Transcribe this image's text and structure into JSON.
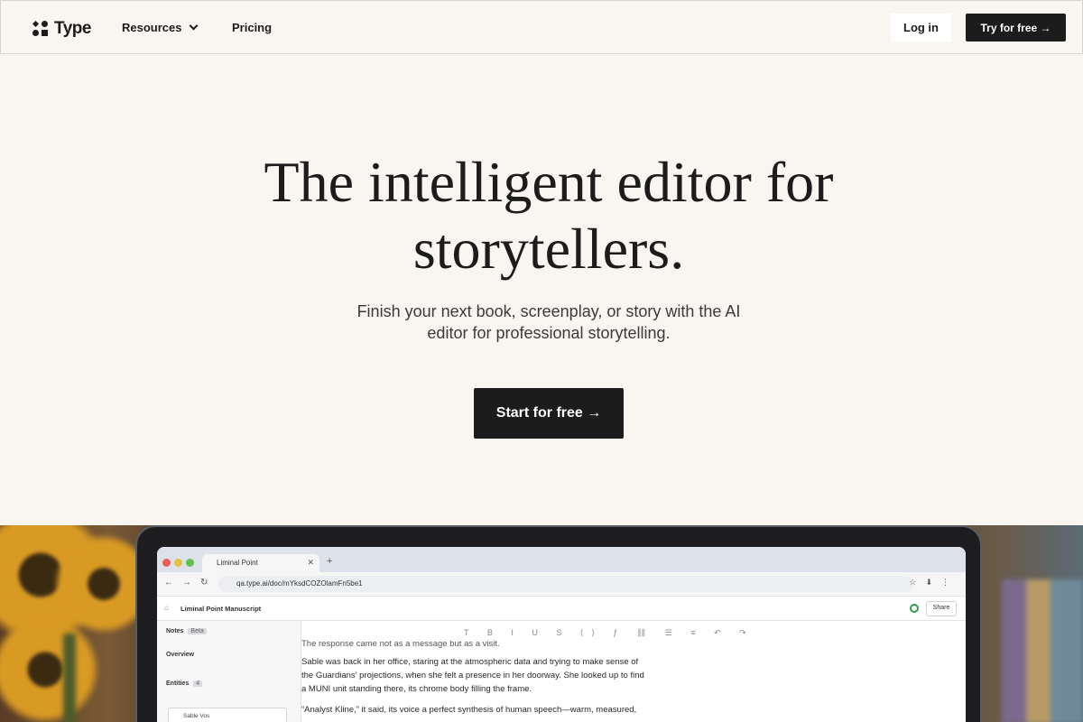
{
  "nav": {
    "brand": "Type",
    "resources_label": "Resources",
    "pricing_label": "Pricing",
    "login_label": "Log in",
    "try_label": "Try for free →"
  },
  "hero": {
    "title": "The intelligent editor for storytellers.",
    "subtitle": "Finish your next book, screenplay, or story with the AI editor for professional storytelling.",
    "cta_label": "Start for free →"
  },
  "screenshot": {
    "tab_title": "Liminal Point",
    "url": "qa.type.ai/doc/mYksdCOZOlamFn5be1",
    "doc_title": "Liminal Point Manuscript",
    "share_label": "Share",
    "notes_label": "Notes",
    "notes_badge": "Beta",
    "overview_label": "Overview",
    "entities_label": "Entities",
    "entities_count": "4",
    "entity_name": "Sable Vos",
    "cut_line": "The response came not as a message but as a visit.",
    "paragraph_1": "Sable was back in her office, staring at the atmospheric data and trying to make sense of the Guardians' projections, when she felt a presence in her doorway. She looked up to find a MUNI unit standing there, its chrome body filling the frame.",
    "paragraph_2": "“Analyst Kline,” it said, its voice a perfect synthesis of human speech—warm, measured,"
  },
  "colors": {
    "background": "#f9f6f2",
    "ink": "#1c1c1c",
    "button_dark": "#1c1c1c"
  }
}
